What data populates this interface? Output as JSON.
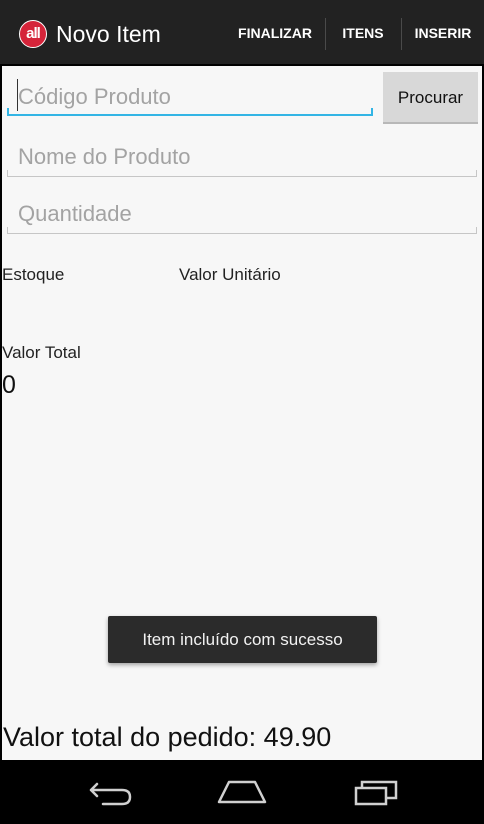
{
  "action_bar": {
    "app_icon_text": "all",
    "title": "Novo Item",
    "actions": [
      "FINALIZAR",
      "ITENS",
      "INSERIR"
    ]
  },
  "form": {
    "codigo_placeholder": "Código Produto",
    "procurar_label": "Procurar",
    "nome_placeholder": "Nome do Produto",
    "quantidade_placeholder": "Quantidade"
  },
  "info": {
    "estoque_label": "Estoque",
    "valor_unitario_label": "Valor Unitário",
    "valor_total_label": "Valor Total",
    "valor_total_value": "0"
  },
  "toast": {
    "message": "Item incluído com sucesso"
  },
  "footer": {
    "total_pedido": "Valor total do pedido: 49.90"
  },
  "nav": {
    "icons": [
      "back-icon",
      "home-icon",
      "recent-apps-icon"
    ]
  },
  "colors": {
    "action_bar": "#222222",
    "focus_accent": "#33b5e5",
    "background": "#f7f7f7",
    "icon_red": "#d5243a"
  }
}
